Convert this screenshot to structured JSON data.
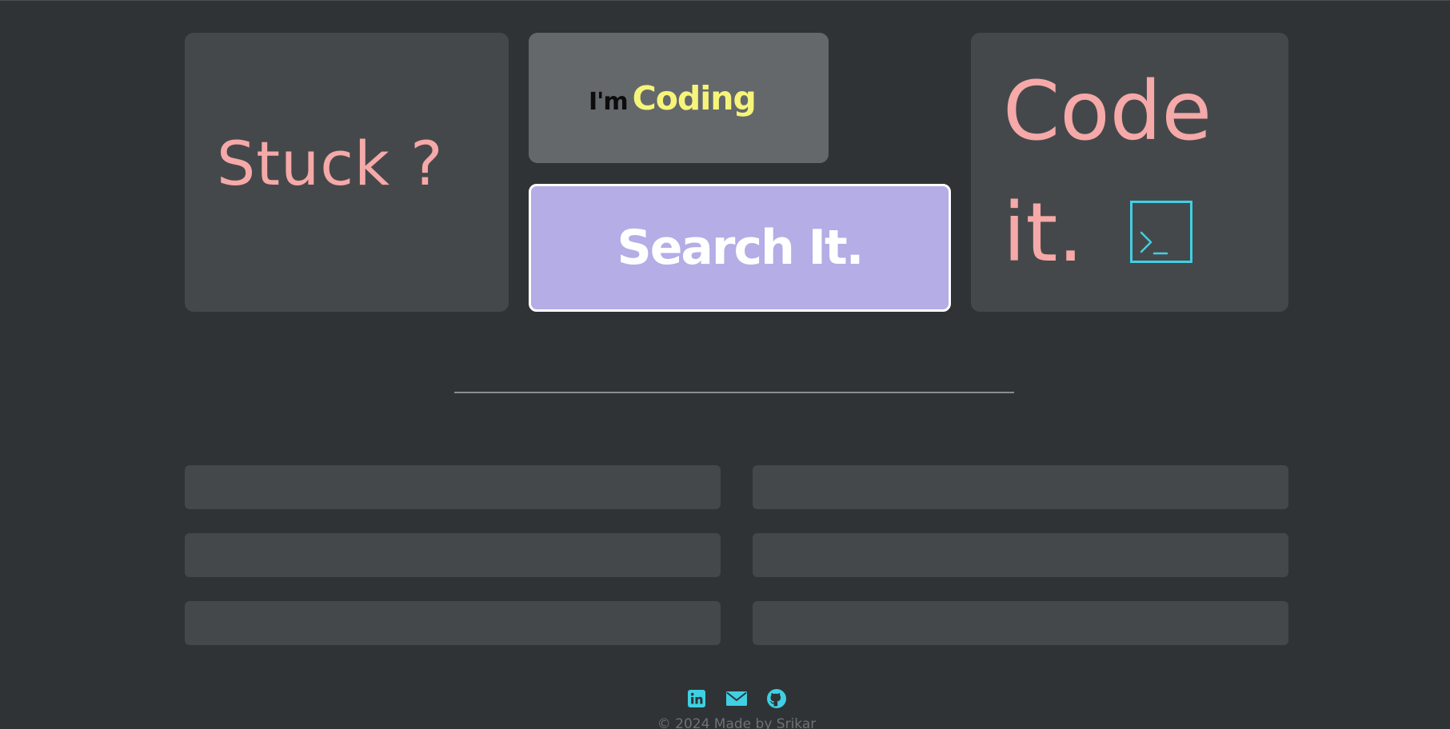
{
  "theme": {
    "background": "#2f3336",
    "card": "#45484b",
    "card_light": "#65686b",
    "accent_pink": "#f5a9a8",
    "accent_yellow": "#f6f57a",
    "accent_lavender": "#b4ade6",
    "accent_cyan": "#3fd0e3"
  },
  "hero": {
    "stuck_label": "Stuck ?",
    "im_label": "I'm",
    "coding_label": "Coding",
    "search_button_label": "Search It.",
    "code_label": "Code",
    "it_label": "it.",
    "terminal_icon": "terminal-icon"
  },
  "link_list": {
    "items": [
      {
        "label": ""
      },
      {
        "label": ""
      },
      {
        "label": ""
      },
      {
        "label": ""
      },
      {
        "label": ""
      },
      {
        "label": ""
      }
    ]
  },
  "footer": {
    "icons": [
      "linkedin-icon",
      "mail-icon",
      "github-icon"
    ],
    "copyright": "© 2024 Made by Srikar"
  }
}
